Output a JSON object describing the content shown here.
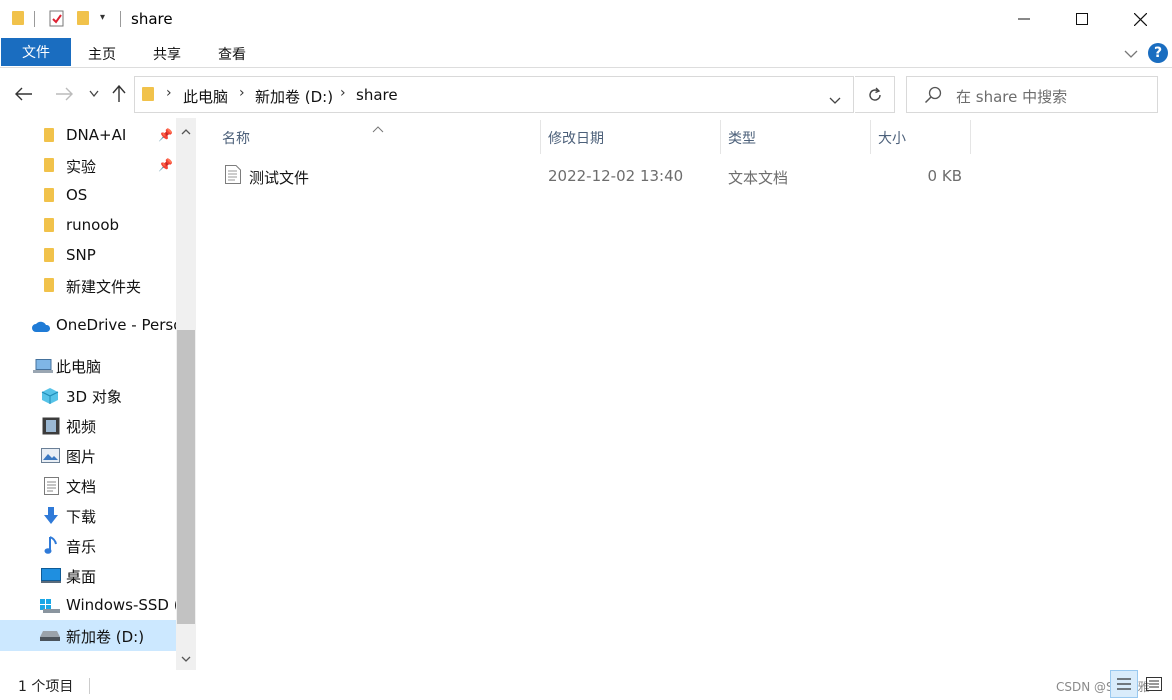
{
  "window": {
    "title": "share",
    "controls": {
      "minimize": "minimize-icon",
      "maximize": "maximize-icon",
      "close": "close-icon"
    }
  },
  "ribbon": {
    "file_tab": "文件",
    "tabs": [
      "主页",
      "共享",
      "查看"
    ],
    "help": "?"
  },
  "address": {
    "breadcrumbs": [
      "此电脑",
      "新加卷 (D:)",
      "share"
    ]
  },
  "search": {
    "placeholder": "在 share 中搜索"
  },
  "nav": {
    "quick_access": [
      {
        "label": "DNA+AI",
        "pinned": true
      },
      {
        "label": "实验",
        "pinned": true
      },
      {
        "label": "OS",
        "pinned": false
      },
      {
        "label": "runoob",
        "pinned": false
      },
      {
        "label": "SNP",
        "pinned": false
      },
      {
        "label": "新建文件夹",
        "pinned": false
      }
    ],
    "onedrive": "OneDrive - Perso",
    "this_pc": "此电脑",
    "pc_items": [
      {
        "label": "3D 对象",
        "icon": "3d-objects-icon"
      },
      {
        "label": "视频",
        "icon": "video-icon"
      },
      {
        "label": "图片",
        "icon": "pictures-icon"
      },
      {
        "label": "文档",
        "icon": "documents-icon"
      },
      {
        "label": "下载",
        "icon": "download-icon"
      },
      {
        "label": "音乐",
        "icon": "music-icon"
      },
      {
        "label": "桌面",
        "icon": "desktop-icon"
      },
      {
        "label": "Windows-SSD (",
        "icon": "windows-drive-icon"
      },
      {
        "label": "新加卷 (D:)",
        "icon": "drive-icon",
        "selected": true
      }
    ]
  },
  "columns": {
    "name": "名称",
    "modified": "修改日期",
    "type": "类型",
    "size": "大小"
  },
  "files": [
    {
      "name": "测试文件",
      "modified": "2022-12-02 13:40",
      "type": "文本文档",
      "size": "0 KB"
    }
  ],
  "status": {
    "count": "1 个项目"
  },
  "watermark": "CSDN @S阿川雅"
}
